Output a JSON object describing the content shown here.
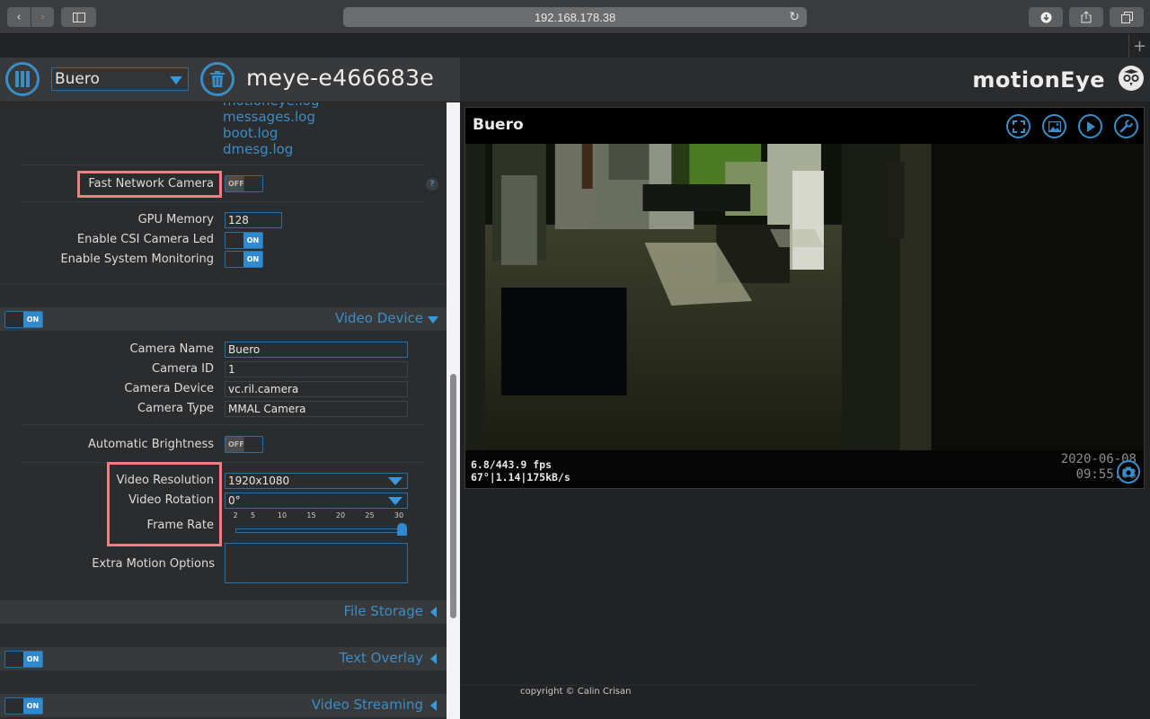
{
  "browser": {
    "url": "192.168.178.38",
    "back_icon": "chevron-left-icon",
    "forward_icon": "chevron-right-icon",
    "sidebar_icon": "sidebar-icon",
    "reload_icon": "reload-icon",
    "download_icon": "download-icon",
    "share_icon": "share-icon",
    "tabs_icon": "tabs-icon",
    "new_tab": "+"
  },
  "header": {
    "camera_selected": "Buero",
    "hostname": "meye-e466683e",
    "brand": "motionEye"
  },
  "logs": [
    "motioneye.log",
    "messages.log",
    "boot.log",
    "dmesg.log"
  ],
  "settings": {
    "fast_network_camera": {
      "label": "Fast Network Camera",
      "state": "OFF"
    },
    "help": "?",
    "gpu_memory": {
      "label": "GPU Memory",
      "value": "128"
    },
    "csi_led": {
      "label": "Enable CSI Camera Led",
      "state": "ON"
    },
    "system_monitoring": {
      "label": "Enable System Monitoring",
      "state": "ON"
    }
  },
  "video_device": {
    "section_title": "Video Device",
    "section_state": "ON",
    "camera_name": {
      "label": "Camera Name",
      "value": "Buero"
    },
    "camera_id": {
      "label": "Camera ID",
      "value": "1"
    },
    "camera_device": {
      "label": "Camera Device",
      "value": "vc.ril.camera"
    },
    "camera_type": {
      "label": "Camera Type",
      "value": "MMAL Camera"
    },
    "auto_brightness": {
      "label": "Automatic Brightness",
      "state": "OFF"
    },
    "video_resolution": {
      "label": "Video Resolution",
      "value": "1920x1080"
    },
    "video_rotation": {
      "label": "Video Rotation",
      "value": "0°"
    },
    "frame_rate": {
      "label": "Frame Rate",
      "ticks": [
        "2",
        "5",
        "10",
        "15",
        "20",
        "25",
        "30"
      ],
      "min": 2,
      "max": 30,
      "value": 30
    },
    "extra_motion_options": {
      "label": "Extra Motion Options",
      "value": ""
    }
  },
  "sections": [
    {
      "title": "File Storage",
      "has_toggle": false
    },
    {
      "title": "Text Overlay",
      "has_toggle": true,
      "state": "ON"
    },
    {
      "title": "Video Streaming",
      "has_toggle": true,
      "state": "ON"
    }
  ],
  "camera_view": {
    "title": "Buero",
    "fps": "6.8/443.9 fps",
    "stats": "67°|1.14|175kB/s",
    "date": "2020-06-08",
    "time": "09:55.08"
  },
  "footer": {
    "copyright": "copyright © Calin Crisan"
  },
  "colors": {
    "accent": "#3b8dc5",
    "highlight": "#ef8080",
    "panel": "#2b2c2e",
    "header": "#38393b"
  }
}
